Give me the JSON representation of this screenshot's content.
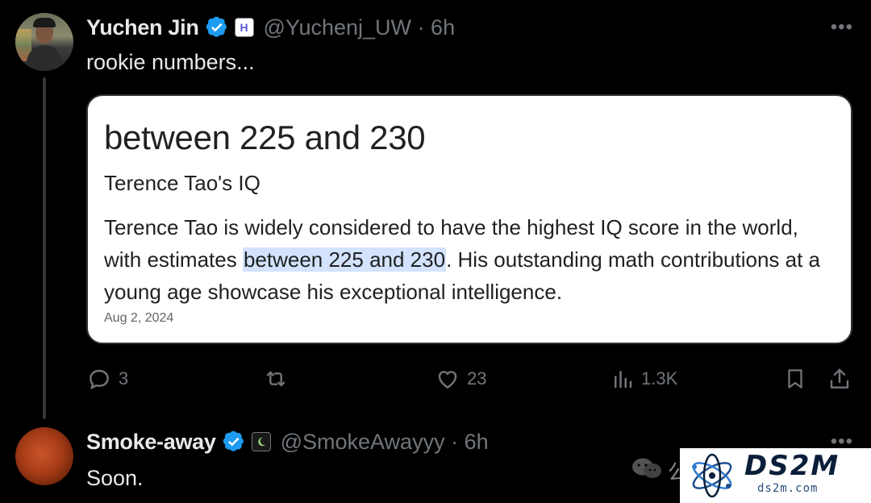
{
  "tweet": {
    "author": {
      "name": "Yuchen Jin",
      "handle": "@Yuchenj_UW",
      "time": "· 6h",
      "affiliation_badge": "H"
    },
    "text": "rookie numbers...",
    "card": {
      "title": "between 225 and 230",
      "subtitle": "Terence Tao's IQ",
      "body_before": "Terence Tao is widely considered to have the highest IQ score in the world, with estimates ",
      "body_highlight": "between 225 and 230",
      "body_after": ". His outstanding math contributions at a young age showcase his exceptional intelligence.",
      "date": "Aug 2, 2024"
    },
    "actions": {
      "replies": "3",
      "reposts": "",
      "likes": "23",
      "views": "1.3K"
    },
    "more_label": "•••"
  },
  "reply": {
    "author": {
      "name": "Smoke-away",
      "handle": "@SmokeAwayyy",
      "time": "· 6h"
    },
    "text": "Soon.",
    "more_label": "•••"
  },
  "watermark": {
    "partial_text": "公",
    "brand": "DS2M",
    "domain": "ds2m.com"
  },
  "colors": {
    "background": "#000000",
    "text_primary": "#e7e9ea",
    "text_secondary": "#71767b",
    "verified_blue": "#1d9bf0",
    "highlight": "#d3e3fd"
  },
  "icons": {
    "reply": "reply-icon",
    "repost": "repost-icon",
    "like": "heart-icon",
    "views": "views-icon",
    "bookmark": "bookmark-icon",
    "share": "share-icon",
    "verified": "verified-badge-icon",
    "more": "more-options-icon"
  }
}
